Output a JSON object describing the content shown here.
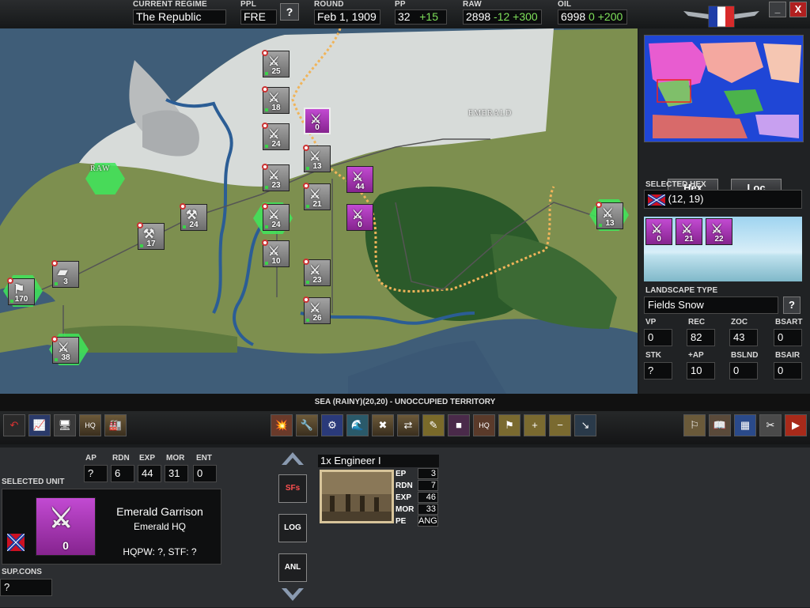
{
  "topbar": {
    "regime_label": "CURRENT REGIME",
    "regime_value": "The Republic",
    "ppl_label": "PPL",
    "ppl_value": "FRE",
    "help_label": "?",
    "round_label": "ROUND",
    "round_value": "Feb 1, 1909",
    "pp_label": "PP",
    "pp_value": "32",
    "pp_delta": "+15",
    "raw_label": "RAW",
    "raw_value": "2898",
    "raw_delta1": "-12",
    "raw_delta2": "+300",
    "oil_label": "OIL",
    "oil_value": "6998",
    "oil_delta1": "0",
    "oil_delta2": "+200",
    "minimize_label": "_",
    "close_label": "X"
  },
  "map": {
    "cities": [
      {
        "label": "RAW"
      },
      {
        "label": "EMERALD"
      }
    ],
    "units": [
      {
        "n": "25",
        "c": "grey"
      },
      {
        "n": "18",
        "c": "grey"
      },
      {
        "n": "24",
        "c": "grey"
      },
      {
        "n": "23",
        "c": "grey"
      },
      {
        "n": "24",
        "c": "grey"
      },
      {
        "n": "10",
        "c": "grey"
      },
      {
        "n": "13",
        "c": "grey"
      },
      {
        "n": "21",
        "c": "grey"
      },
      {
        "n": "23",
        "c": "grey"
      },
      {
        "n": "26",
        "c": "grey"
      },
      {
        "n": "24",
        "c": "grey"
      },
      {
        "n": "17",
        "c": "grey"
      },
      {
        "n": "3",
        "c": "grey"
      },
      {
        "n": "170",
        "c": "grey"
      },
      {
        "n": "38",
        "c": "grey"
      },
      {
        "n": "13",
        "c": "grey"
      },
      {
        "n": "0",
        "c": "purple"
      },
      {
        "n": "44",
        "c": "purple"
      },
      {
        "n": "0",
        "c": "purple"
      }
    ]
  },
  "right_panel": {
    "hex_button": "Hex",
    "loc_button": "Loc",
    "selected_hex_label": "SELECTED HEX",
    "selected_hex_value": "(12, 19)",
    "hex_units": [
      "0",
      "21",
      "22"
    ],
    "landscape_label": "LANDSCAPE TYPE",
    "landscape_value": "Fields Snow",
    "landscape_help": "?",
    "stats": [
      {
        "label": "VP",
        "value": "0"
      },
      {
        "label": "REC",
        "value": "82"
      },
      {
        "label": "ZOC",
        "value": "43"
      },
      {
        "label": "BSART",
        "value": "0"
      },
      {
        "label": "STK",
        "value": "?"
      },
      {
        "label": "+AP",
        "value": "10"
      },
      {
        "label": "BSLND",
        "value": "0"
      },
      {
        "label": "BSAIR",
        "value": "0"
      }
    ]
  },
  "status_text": "SEA (RAINY)(20,20) - UNOCCUPIED TERRITORY",
  "toolbar": {
    "left": [
      "↶",
      "📈",
      "🖥",
      "HQ",
      "🏭"
    ],
    "center": [
      "💥",
      "🔧",
      "⚙",
      "🌊",
      "✖",
      "⇄",
      "✎",
      "■",
      "HQ",
      "⚑",
      "+",
      "−",
      "↘"
    ],
    "right": [
      "⚐",
      "📖",
      "▦",
      "✂",
      "▶"
    ]
  },
  "selected_unit": {
    "header": "SELECTED UNIT",
    "fields": [
      {
        "label": "AP",
        "value": "?"
      },
      {
        "label": "RDN",
        "value": "6"
      },
      {
        "label": "EXP",
        "value": "44"
      },
      {
        "label": "MOR",
        "value": "31"
      },
      {
        "label": "ENT",
        "value": "0"
      }
    ],
    "name": "Emerald Garrison",
    "hq": "Emerald HQ",
    "hqpw": "HQPW: ?, STF: ?",
    "strength": "0",
    "supcons_label": "SUP.CONS",
    "supcons_value": "?"
  },
  "nav_buttons": {
    "sfs": "SFs",
    "log": "LOG",
    "anl": "ANL"
  },
  "sub_unit": {
    "title": "1x Engineer I",
    "rows": [
      {
        "label": "EP",
        "value": "3"
      },
      {
        "label": "RDN",
        "value": "7"
      },
      {
        "label": "EXP",
        "value": "46"
      },
      {
        "label": "MOR",
        "value": "33"
      },
      {
        "label": "PE",
        "value": "ANG"
      }
    ]
  }
}
